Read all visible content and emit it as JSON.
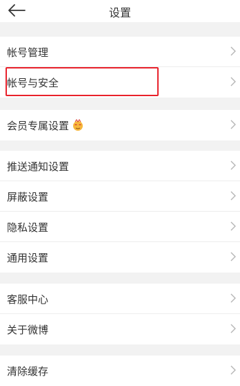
{
  "header": {
    "title": "设置"
  },
  "groups": [
    {
      "items": [
        {
          "label": "帐号管理"
        },
        {
          "label": "帐号与安全"
        }
      ]
    },
    {
      "items": [
        {
          "label": "会员专属设置"
        }
      ]
    },
    {
      "items": [
        {
          "label": "推送通知设置"
        },
        {
          "label": "屏蔽设置"
        },
        {
          "label": "隐私设置"
        },
        {
          "label": "通用设置"
        }
      ]
    },
    {
      "items": [
        {
          "label": "客服中心"
        },
        {
          "label": "关于微博"
        }
      ]
    },
    {
      "items": [
        {
          "label": "清除缓存"
        }
      ]
    }
  ],
  "icons": {
    "back": "back-arrow-icon",
    "chevron": "chevron-right-icon",
    "vip_emoji": "vip-emoji-icon"
  },
  "colors": {
    "highlight": "#e8212b",
    "background": "#f2f2f2"
  }
}
